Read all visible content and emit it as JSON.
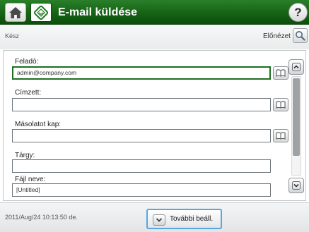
{
  "header": {
    "title": "E-mail küldése",
    "accent_color": "#156315"
  },
  "status": {
    "text": "Kész",
    "preview_label": "Előnézet"
  },
  "form": {
    "fields": [
      {
        "label": "Feladó:",
        "value": "admin@company.com",
        "has_address_book": true,
        "active": true
      },
      {
        "label": "Címzett:",
        "value": "",
        "has_address_book": true,
        "active": false
      },
      {
        "label": "Másolatot kap:",
        "value": "",
        "has_address_book": true,
        "active": false
      },
      {
        "label": "Tárgy:",
        "value": "",
        "has_address_book": false,
        "active": false
      },
      {
        "label": "Fájl neve:",
        "value": "[Untitled]",
        "has_address_book": false,
        "active": false
      }
    ]
  },
  "footer": {
    "datetime": "2011/Aug/24 10:13:50 de.",
    "more_options_label": "További beáll."
  },
  "icons": {
    "home": "home-icon",
    "app": "email-icon",
    "help": "help-icon",
    "preview": "magnifier-icon",
    "address_book": "address-book-icon",
    "scroll_up": "chevron-up-icon",
    "scroll_down": "chevron-down-icon",
    "more": "chevron-down-icon"
  }
}
